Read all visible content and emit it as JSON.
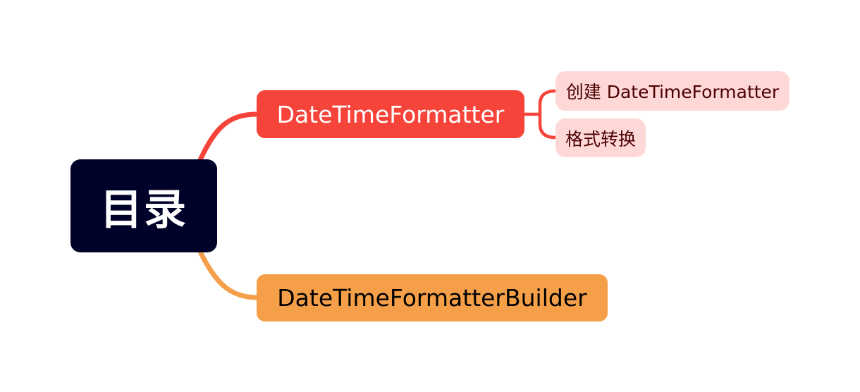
{
  "colors": {
    "background": "#ffffff",
    "root_bg": "#000229",
    "root_text": "#ffffff",
    "branch_red": "#f7443b",
    "branch_red_text": "#ffffff",
    "branch_orange": "#f5a049",
    "branch_orange_text": "#000000",
    "leaf_bg": "#fed8d6",
    "leaf_text": "#4a0000"
  },
  "mindmap": {
    "root": {
      "label": "目录"
    },
    "branches": [
      {
        "label": "DateTimeFormatter",
        "children": [
          {
            "label": "创建 DateTimeFormatter"
          },
          {
            "label": "格式转换"
          }
        ]
      },
      {
        "label": "DateTimeFormatterBuilder",
        "children": []
      }
    ]
  }
}
